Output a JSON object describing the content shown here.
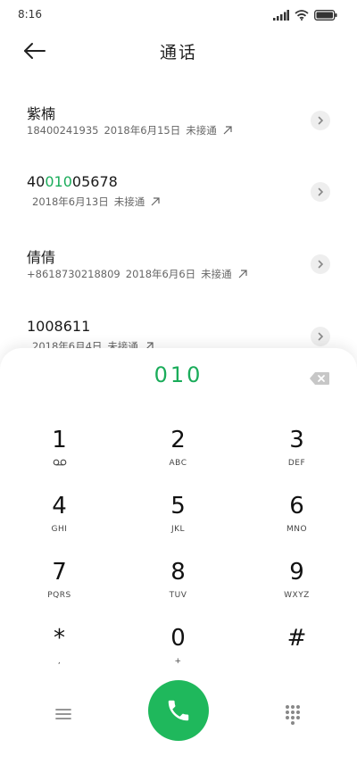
{
  "status": {
    "time": "8:16"
  },
  "header": {
    "title": "通话"
  },
  "calls": [
    {
      "name_pre": "",
      "name_match": "",
      "name_post": "紫楠",
      "number": "18400241935",
      "date": "2018年6月15日",
      "status": "未接通"
    },
    {
      "name_pre": "40",
      "name_match": "010",
      "name_post": "05678",
      "number": "",
      "date": "2018年6月13日",
      "status": "未接通"
    },
    {
      "name_pre": "",
      "name_match": "",
      "name_post": "倩倩",
      "number": "+8618730218809",
      "date": "2018年6月6日",
      "status": "未接通"
    },
    {
      "name_pre": "",
      "name_match": "",
      "name_post": "1008611",
      "number": "",
      "date": "2018年6月4日",
      "status": "未接通"
    }
  ],
  "dialpad": {
    "number": "010",
    "keys": [
      {
        "digit": "1",
        "letters": ""
      },
      {
        "digit": "2",
        "letters": "ABC"
      },
      {
        "digit": "3",
        "letters": "DEF"
      },
      {
        "digit": "4",
        "letters": "GHI"
      },
      {
        "digit": "5",
        "letters": "JKL"
      },
      {
        "digit": "6",
        "letters": "MNO"
      },
      {
        "digit": "7",
        "letters": "PQRS"
      },
      {
        "digit": "8",
        "letters": "TUV"
      },
      {
        "digit": "9",
        "letters": "WXYZ"
      },
      {
        "digit": "*",
        "letters": ","
      },
      {
        "digit": "0",
        "letters": "+"
      },
      {
        "digit": "#",
        "letters": ""
      }
    ]
  },
  "colors": {
    "accent": "#1aac5a",
    "call_button": "#1fb85c"
  }
}
